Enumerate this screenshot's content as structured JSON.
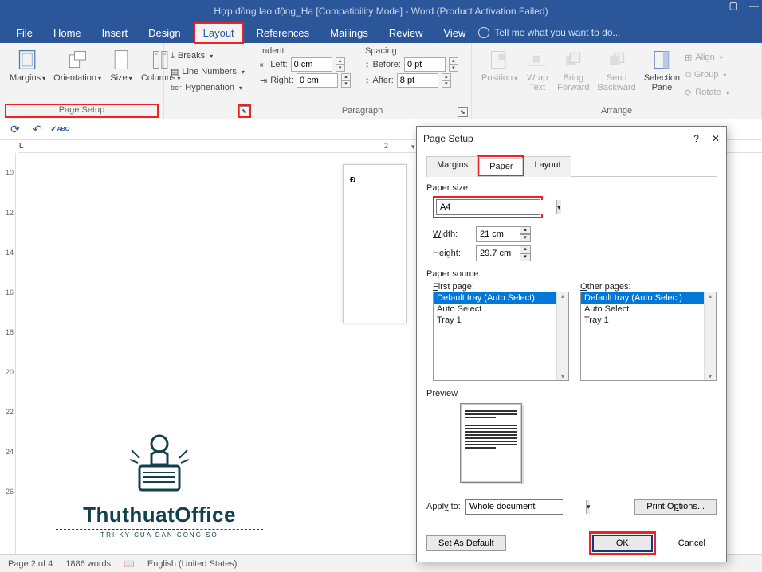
{
  "title": "Hợp đồng lao động_Ha [Compatibility Mode] - Word (Product Activation Failed)",
  "menu": {
    "file": "File",
    "home": "Home",
    "insert": "Insert",
    "design": "Design",
    "layout": "Layout",
    "references": "References",
    "mailings": "Mailings",
    "review": "Review",
    "view": "View",
    "tell": "Tell me what you want to do..."
  },
  "ribbon": {
    "pagesetup": {
      "label": "Page Setup",
      "margins": "Margins",
      "orientation": "Orientation",
      "size": "Size",
      "columns": "Columns",
      "breaks": "Breaks",
      "linenum": "Line Numbers",
      "hyphen": "Hyphenation"
    },
    "indent": {
      "header": "Indent",
      "left": "Left:",
      "leftVal": "0 cm",
      "right": "Right:",
      "rightVal": "0 cm"
    },
    "spacing": {
      "header": "Spacing",
      "before": "Before:",
      "beforeVal": "0 pt",
      "after": "After:",
      "afterVal": "8 pt"
    },
    "paragraph": {
      "label": "Paragraph"
    },
    "arrange": {
      "label": "Arrange",
      "position": "Position",
      "wrap": "Wrap\nText",
      "forward": "Bring\nForward",
      "backward": "Send\nBackward",
      "selpane": "Selection\nPane",
      "align": "Align",
      "group": "Group",
      "rotate": "Rotate"
    }
  },
  "ruler": {
    "h2": "2",
    "vTicks": [
      "10",
      "12",
      "14",
      "16",
      "18",
      "20",
      "22",
      "24",
      "26"
    ]
  },
  "page_text": "Đ",
  "logo": {
    "line1": "ThuthuatOffice",
    "line2": "TRI KY CUA DAN CONG SO"
  },
  "status": {
    "page": "Page 2 of 4",
    "words": "1886 words",
    "lang": "English (United States)"
  },
  "dialog": {
    "title": "Page Setup",
    "help": "?",
    "close": "✕",
    "tabs": {
      "margins": "Margins",
      "paper": "Paper",
      "layout": "Layout"
    },
    "paperSizeLabel": "Paper size:",
    "paperSize": "A4",
    "widthLabel": "Width:",
    "widthVal": "21 cm",
    "heightLabel": "Height:",
    "heightVal": "29.7 cm",
    "paperSource": "Paper source",
    "firstPage": "First page:",
    "otherPages": "Other pages:",
    "trays": [
      "Default tray (Auto Select)",
      "Auto Select",
      "Tray 1"
    ],
    "preview": "Preview",
    "applyTo": "Apply to:",
    "applyVal": "Whole document",
    "printOpt": "Print Options...",
    "setDefault": "Set As Default",
    "ok": "OK",
    "cancel": "Cancel"
  }
}
